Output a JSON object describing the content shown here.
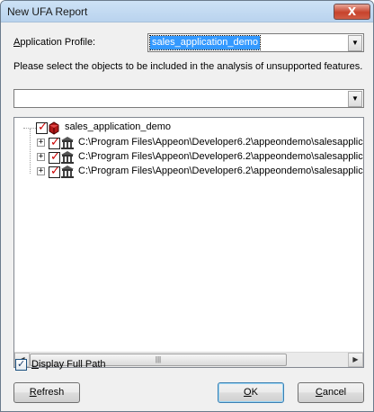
{
  "window": {
    "title": "New UFA Report",
    "close_glyph": "X"
  },
  "profile": {
    "label_accel": "A",
    "label_rest": "pplication Profile:",
    "selected": "sales_application_demo"
  },
  "instruction": "Please select the objects to be included in the analysis of unsupported features.",
  "filter": {
    "value": ""
  },
  "tree": {
    "root": {
      "label": "sales_application_demo",
      "checked": true,
      "icon": "application-icon"
    },
    "children": [
      {
        "label": "C:\\Program Files\\Appeon\\Developer6.2\\appeondemo\\salesapplic",
        "checked": true,
        "icon": "library-icon",
        "expander": "+"
      },
      {
        "label": "C:\\Program Files\\Appeon\\Developer6.2\\appeondemo\\salesapplic",
        "checked": true,
        "icon": "library-icon",
        "expander": "+"
      },
      {
        "label": "C:\\Program Files\\Appeon\\Developer6.2\\appeondemo\\salesapplic",
        "checked": true,
        "icon": "library-icon",
        "expander": "+"
      }
    ],
    "scroll_position": 0.0
  },
  "display_full_path": {
    "checked": true,
    "label_accel": "D",
    "label_rest": "isplay Full Path"
  },
  "buttons": {
    "refresh_accel": "R",
    "refresh_rest": "efresh",
    "ok_accel": "O",
    "ok_rest": "K",
    "cancel_accel": "C",
    "cancel_rest": "ancel"
  },
  "colors": {
    "selection": "#3399ff",
    "check": "#cc0000",
    "titlebar": "#c4dbf3"
  }
}
